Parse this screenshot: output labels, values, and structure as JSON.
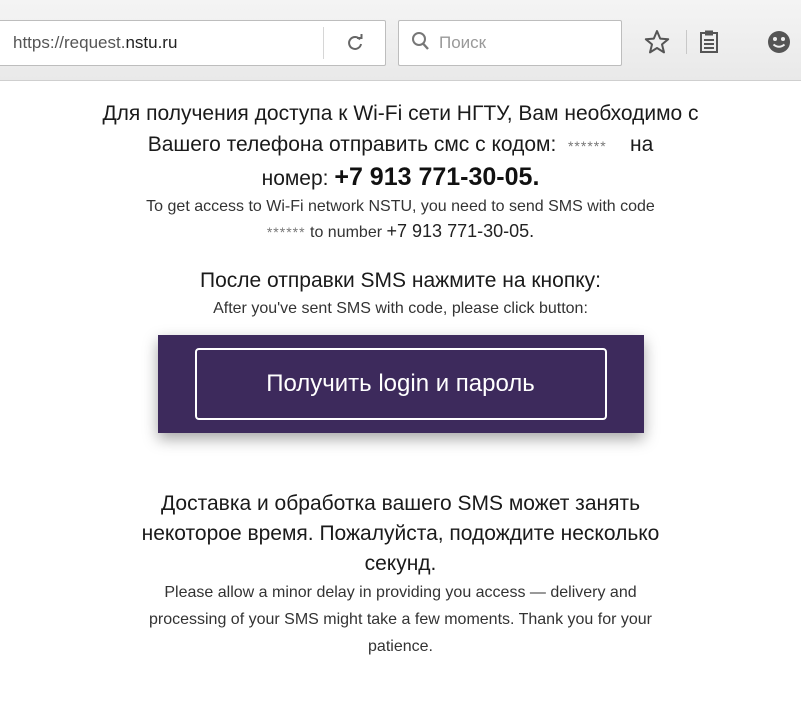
{
  "browser": {
    "url_prefix": "https://request.",
    "url_domain": "nstu.ru",
    "search_placeholder": "Поиск",
    "icons": [
      "reload-icon",
      "search-icon",
      "bookmark-star-icon",
      "reading-list-icon",
      "smiley-icon"
    ]
  },
  "page": {
    "ru_intro_line1": "Для получения доступа к Wi-Fi сети НГТУ, Вам необходимо с",
    "ru_intro_line2": "Вашего телефона отправить смс с кодом:",
    "code_mask": "******",
    "ru_intro_na": "на",
    "ru_intro_number_label": "номер:",
    "phone_number": "+7 913 771-30-05.",
    "en_intro_line1": "To get access to Wi-Fi network NSTU, you need to send SMS with code",
    "en_intro_to_number": "to number",
    "ru_after_sms": "После отправки SMS нажмите на кнопку:",
    "en_after_sms": "After you've sent SMS with code, please click button:",
    "button_label": "Получить login и пароль",
    "ru_delay_line1": "Доставка и обработка вашего SMS может занять",
    "ru_delay_line2": "некоторое время. Пожалуйста, подождите несколько",
    "ru_delay_line3": "секунд.",
    "en_delay_line1": "Please allow a minor delay in providing you access — delivery and",
    "en_delay_line2": "processing of your SMS might take a few moments. Thank you for your",
    "en_delay_line3": "patience."
  },
  "colors": {
    "button_bg": "#3d2a5c",
    "button_text": "#ffffff",
    "toolbar_bg": "#efefef"
  }
}
